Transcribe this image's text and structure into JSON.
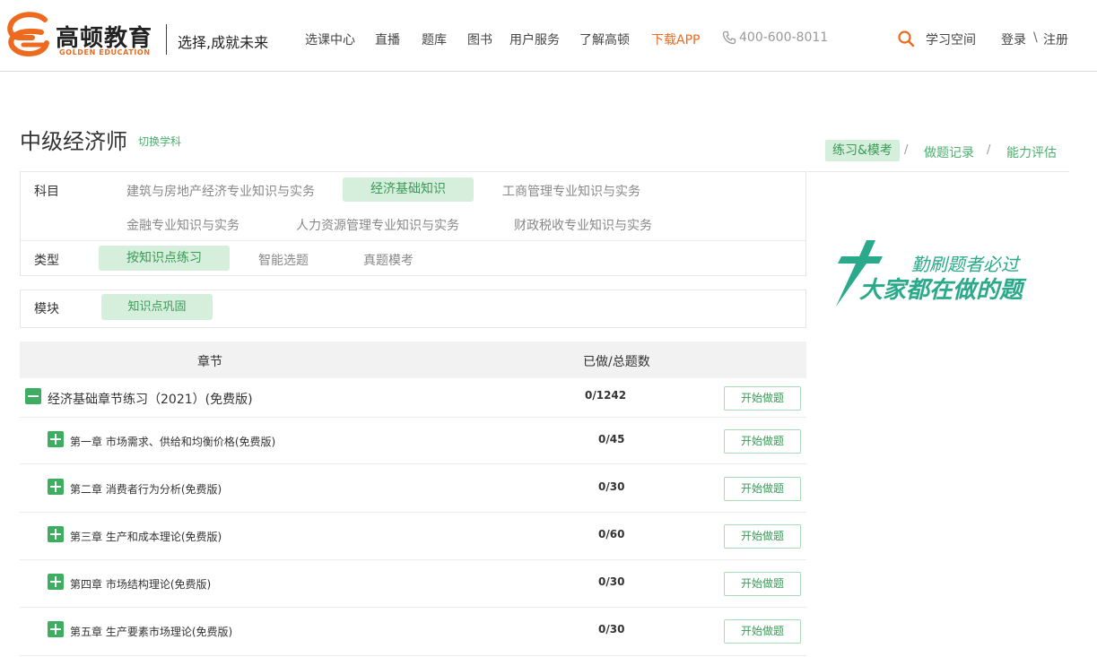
{
  "header": {
    "logo_cn": "高顿教育",
    "logo_en": "GOLDEN EDUCATION",
    "slogan": "选择,成就未来",
    "nav": [
      {
        "label": "选课中心"
      },
      {
        "label": "直播"
      },
      {
        "label": "题库"
      },
      {
        "label": "图书"
      },
      {
        "label": "用户服务"
      },
      {
        "label": "了解高顿"
      },
      {
        "label": "下载APP"
      }
    ],
    "phone": "400-600-8011",
    "study_space": "学习空间",
    "login": "登录",
    "separator": "\\",
    "register": "注册",
    "accent_color": "#ee6a1e"
  },
  "page": {
    "title": "中级经济师",
    "switch_subject": "切换学科",
    "right_tabs": [
      {
        "label": "练习&模考"
      },
      {
        "label": "做题记录"
      },
      {
        "label": "能力评估"
      }
    ],
    "tab_separator": "/",
    "accent_color": "#3dae5f"
  },
  "filters": {
    "subject": {
      "label": "科目",
      "options": [
        {
          "label": "建筑与房地产经济专业知识与实务"
        },
        {
          "label": "经济基础知识",
          "selected": true
        },
        {
          "label": "工商管理专业知识与实务"
        },
        {
          "label": "金融专业知识与实务"
        },
        {
          "label": "人力资源管理专业知识与实务"
        },
        {
          "label": "财政税收专业知识与实务"
        }
      ]
    },
    "type": {
      "label": "类型",
      "options": [
        {
          "label": "按知识点练习",
          "selected": true
        },
        {
          "label": "智能选题"
        },
        {
          "label": "真题模考"
        }
      ]
    },
    "module": {
      "label": "模块",
      "options": [
        {
          "label": "知识点巩固",
          "selected": true
        }
      ]
    }
  },
  "table": {
    "headers": {
      "chapter": "章节",
      "progress": "已做/总题数"
    },
    "parent": {
      "name": "经济基础章节练习（2021）(免费版)",
      "progress": "0/1242",
      "button": "开始做题",
      "expanded": true
    },
    "children": [
      {
        "name": "第一章 市场需求、供给和均衡价格(免费版)",
        "progress": "0/45",
        "button": "开始做题"
      },
      {
        "name": "第二章 消费者行为分析(免费版)",
        "progress": "0/30",
        "button": "开始做题"
      },
      {
        "name": "第三章 生产和成本理论(免费版)",
        "progress": "0/60",
        "button": "开始做题"
      },
      {
        "name": "第四章 市场结构理论(免费版)",
        "progress": "0/30",
        "button": "开始做题"
      },
      {
        "name": "第五章 生产要素市场理论(免费版)",
        "progress": "0/30",
        "button": "开始做题"
      }
    ]
  },
  "promo": {
    "line1": "勤刷题者必过",
    "line2": "大家都在做的题",
    "color": "#2aaa8a"
  }
}
